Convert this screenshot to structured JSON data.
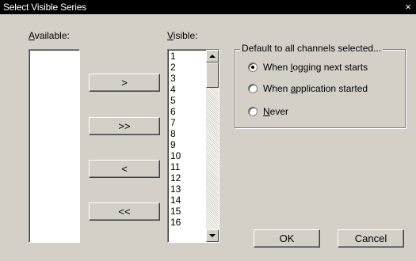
{
  "window": {
    "title": "Select Visible Series",
    "close_glyph": "×"
  },
  "available": {
    "label_mnemonic": "A",
    "label_rest": "vailable:",
    "items": []
  },
  "visible": {
    "label_mnemonic": "V",
    "label_rest": "isible:",
    "items": [
      "1",
      "2",
      "3",
      "4",
      "5",
      "6",
      "7",
      "8",
      "9",
      "10",
      "11",
      "12",
      "13",
      "14",
      "15",
      "16"
    ]
  },
  "buttons": {
    "add": ">",
    "add_all": ">>",
    "remove": "<",
    "remove_all": "<<",
    "ok": "OK",
    "cancel": "Cancel"
  },
  "default_group": {
    "legend": "Default to all channels selected...",
    "options": [
      {
        "pre": "When ",
        "mnemonic": "l",
        "post": "ogging next starts",
        "selected": true
      },
      {
        "pre": "When ",
        "mnemonic": "a",
        "post": "pplication started",
        "selected": false
      },
      {
        "pre": "",
        "mnemonic": "N",
        "post": "ever",
        "selected": false
      }
    ]
  },
  "icons": {
    "scroll_up": "scroll-up-arrow-icon",
    "scroll_down": "scroll-down-arrow-icon",
    "close": "close-icon"
  }
}
